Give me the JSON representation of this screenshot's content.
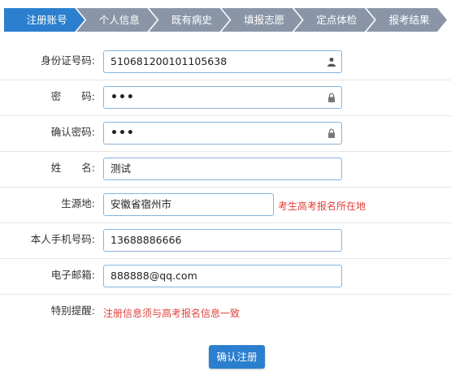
{
  "steps": [
    {
      "label": "注册账号",
      "active": true
    },
    {
      "label": "个人信息",
      "active": false
    },
    {
      "label": "既有病史",
      "active": false
    },
    {
      "label": "填报志愿",
      "active": false
    },
    {
      "label": "定点体检",
      "active": false
    },
    {
      "label": "报考结果",
      "active": false
    }
  ],
  "form": {
    "id_card": {
      "label": "身份证号码:",
      "value": "510681200101105638",
      "icon": "user-icon"
    },
    "password": {
      "label": "密　　码:",
      "value": "•••",
      "icon": "lock-icon"
    },
    "confirm_password": {
      "label": "确认密码:",
      "value": "•••",
      "icon": "lock-icon"
    },
    "name": {
      "label": "姓　　名:",
      "value": "测试"
    },
    "origin": {
      "label": "生源地:",
      "value": "安徽省宿州市",
      "hint": "考生高考报名所在地"
    },
    "phone": {
      "label": "本人手机号码:",
      "value": "13688886666"
    },
    "email": {
      "label": "电子邮箱:",
      "value": "888888@qq.com"
    },
    "notice": {
      "label": "特别提醒:",
      "text": "注册信息须与高考报名信息一致"
    }
  },
  "submit_label": "确认注册",
  "colors": {
    "accent": "#2b7fce",
    "inactive_step": "#8a96a8",
    "warning": "#e0413a",
    "input_border": "#88b4dc"
  }
}
